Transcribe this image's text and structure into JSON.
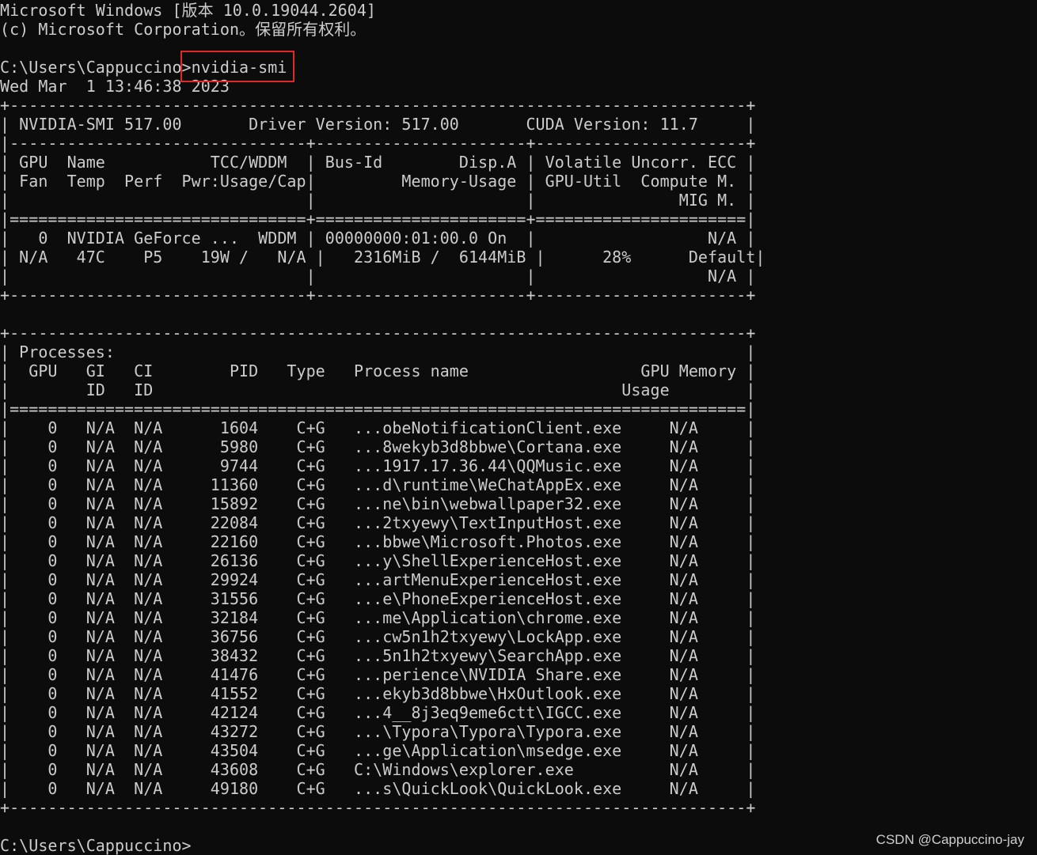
{
  "terminal": {
    "header": {
      "os_version": "Microsoft Windows [版本 10.0.19044.2604]",
      "copyright": "(c) Microsoft Corporation。保留所有权利。"
    },
    "prompt_path": "C:\\Users\\Cappuccino>",
    "command": "nvidia-smi",
    "timestamp": "Wed Mar  1 13:46:38 2023",
    "info": {
      "smi_version": "NVIDIA-SMI 517.00",
      "driver_label": "Driver Version:",
      "driver_version": "517.00",
      "cuda_label": "CUDA Version:",
      "cuda_version": "11.7"
    },
    "gpu_table": {
      "headers": [
        [
          "GPU",
          "Name",
          "TCC/WDDM",
          "Bus-Id",
          "Disp.A",
          "Volatile Uncorr. ECC"
        ],
        [
          "Fan",
          "Temp",
          "Perf",
          "Pwr:Usage/Cap",
          "Memory-Usage",
          "GPU-Util",
          "Compute M."
        ],
        [
          "MIG M."
        ]
      ],
      "gpu": {
        "index": "0",
        "name": "NVIDIA GeForce ...",
        "driver_model": "WDDM",
        "bus_id": "00000000:01:00.0",
        "disp_a": "On",
        "ecc": "N/A",
        "fan": "N/A",
        "temp": "47C",
        "perf": "P5",
        "power": "19W /   N/A",
        "memory_usage": "2316MiB /  6144MiB",
        "gpu_util": "28%",
        "compute_mode": "Default",
        "mig_mode": "N/A"
      }
    },
    "processes": {
      "title": "Processes:",
      "header_row1": [
        "GPU",
        "GI",
        "CI",
        "PID",
        "Type",
        "Process name",
        "GPU Memory"
      ],
      "header_row2": [
        "ID",
        "ID",
        "Usage"
      ],
      "rows": [
        {
          "gpu": "0",
          "gi": "N/A",
          "ci": "N/A",
          "pid": "1604",
          "type": "C+G",
          "name": "...obeNotificationClient.exe",
          "mem": "N/A"
        },
        {
          "gpu": "0",
          "gi": "N/A",
          "ci": "N/A",
          "pid": "5980",
          "type": "C+G",
          "name": "...8wekyb3d8bbwe\\Cortana.exe",
          "mem": "N/A"
        },
        {
          "gpu": "0",
          "gi": "N/A",
          "ci": "N/A",
          "pid": "9744",
          "type": "C+G",
          "name": "...1917.17.36.44\\QQMusic.exe",
          "mem": "N/A"
        },
        {
          "gpu": "0",
          "gi": "N/A",
          "ci": "N/A",
          "pid": "11360",
          "type": "C+G",
          "name": "...d\\runtime\\WeChatAppEx.exe",
          "mem": "N/A"
        },
        {
          "gpu": "0",
          "gi": "N/A",
          "ci": "N/A",
          "pid": "15892",
          "type": "C+G",
          "name": "...ne\\bin\\webwallpaper32.exe",
          "mem": "N/A"
        },
        {
          "gpu": "0",
          "gi": "N/A",
          "ci": "N/A",
          "pid": "22084",
          "type": "C+G",
          "name": "...2txyewy\\TextInputHost.exe",
          "mem": "N/A"
        },
        {
          "gpu": "0",
          "gi": "N/A",
          "ci": "N/A",
          "pid": "22160",
          "type": "C+G",
          "name": "...bbwe\\Microsoft.Photos.exe",
          "mem": "N/A"
        },
        {
          "gpu": "0",
          "gi": "N/A",
          "ci": "N/A",
          "pid": "26136",
          "type": "C+G",
          "name": "...y\\ShellExperienceHost.exe",
          "mem": "N/A"
        },
        {
          "gpu": "0",
          "gi": "N/A",
          "ci": "N/A",
          "pid": "29924",
          "type": "C+G",
          "name": "...artMenuExperienceHost.exe",
          "mem": "N/A"
        },
        {
          "gpu": "0",
          "gi": "N/A",
          "ci": "N/A",
          "pid": "31556",
          "type": "C+G",
          "name": "...e\\PhoneExperienceHost.exe",
          "mem": "N/A"
        },
        {
          "gpu": "0",
          "gi": "N/A",
          "ci": "N/A",
          "pid": "32184",
          "type": "C+G",
          "name": "...me\\Application\\chrome.exe",
          "mem": "N/A"
        },
        {
          "gpu": "0",
          "gi": "N/A",
          "ci": "N/A",
          "pid": "36756",
          "type": "C+G",
          "name": "...cw5n1h2txyewy\\LockApp.exe",
          "mem": "N/A"
        },
        {
          "gpu": "0",
          "gi": "N/A",
          "ci": "N/A",
          "pid": "38432",
          "type": "C+G",
          "name": "...5n1h2txyewy\\SearchApp.exe",
          "mem": "N/A"
        },
        {
          "gpu": "0",
          "gi": "N/A",
          "ci": "N/A",
          "pid": "41476",
          "type": "C+G",
          "name": "...perience\\NVIDIA Share.exe",
          "mem": "N/A"
        },
        {
          "gpu": "0",
          "gi": "N/A",
          "ci": "N/A",
          "pid": "41552",
          "type": "C+G",
          "name": "...ekyb3d8bbwe\\HxOutlook.exe",
          "mem": "N/A"
        },
        {
          "gpu": "0",
          "gi": "N/A",
          "ci": "N/A",
          "pid": "42124",
          "type": "C+G",
          "name": "...4__8j3eq9eme6ctt\\IGCC.exe",
          "mem": "N/A"
        },
        {
          "gpu": "0",
          "gi": "N/A",
          "ci": "N/A",
          "pid": "43272",
          "type": "C+G",
          "name": "...\\Typora\\Typora\\Typora.exe",
          "mem": "N/A"
        },
        {
          "gpu": "0",
          "gi": "N/A",
          "ci": "N/A",
          "pid": "43504",
          "type": "C+G",
          "name": "...ge\\Application\\msedge.exe",
          "mem": "N/A"
        },
        {
          "gpu": "0",
          "gi": "N/A",
          "ci": "N/A",
          "pid": "43608",
          "type": "C+G",
          "name": "C:\\Windows\\explorer.exe",
          "mem": "N/A"
        },
        {
          "gpu": "0",
          "gi": "N/A",
          "ci": "N/A",
          "pid": "49180",
          "type": "C+G",
          "name": "...s\\QuickLook\\QuickLook.exe",
          "mem": "N/A"
        }
      ]
    },
    "final_prompt": "C:\\Users\\Cappuccino>"
  },
  "watermark": "CSDN @Cappuccino-jay",
  "colors": {
    "background": "#0c0c0c",
    "text": "#cccccc",
    "highlight_box": "#e02a2a"
  }
}
